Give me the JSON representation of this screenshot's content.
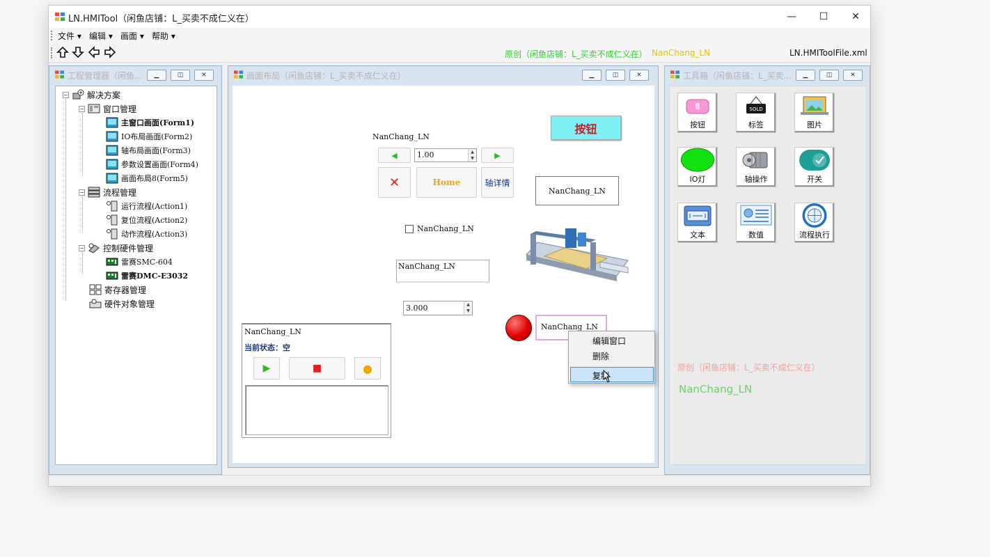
{
  "window": {
    "title": "LN.HMITool（闲鱼店铺：L_买卖不成仁义在）",
    "minimize": "—",
    "maximize": "☐",
    "close": "✕"
  },
  "menu": [
    "文件 ▾",
    "编辑 ▾",
    "画面 ▾",
    "帮助 ▾"
  ],
  "toolbar": {
    "arrows": [
      "up-arrow-icon",
      "down-arrow-icon",
      "left-arrow-icon",
      "right-arrow-icon"
    ],
    "credit_green": "原创（闲鱼店铺：L_买卖不成仁义在）",
    "credit_yellow": "NanChang_LN",
    "file_name": "LN.HMIToolFile.xml"
  },
  "project_manager": {
    "title": "工程管理器（闲鱼...",
    "root": "解决方案",
    "window_mgmt": "窗口管理",
    "forms": [
      "主窗口画面(Form1)",
      "IO布局画面(Form2)",
      "轴布局画面(Form3)",
      "参数设置画面(Form4)",
      "画面布局8(Form5)"
    ],
    "flow_mgmt": "流程管理",
    "flows": [
      "运行流程(Action1)",
      "复位流程(Action2)",
      "动作流程(Action3)"
    ],
    "hw_mgmt": "控制硬件管理",
    "hardware": [
      "雷赛SMC-604",
      "雷赛DMC-E3032"
    ],
    "register_mgmt": "寄存器管理",
    "hw_object_mgmt": "硬件对象管理"
  },
  "layout_window": {
    "title": "画面布局（闲鱼店铺：L_买卖不成仁义在）",
    "axis_label": "NanChang_LN",
    "axis_value": "1.00",
    "left_arrow": "◀",
    "right_arrow": "▶",
    "stop_mark": "✕",
    "home_label": "Home",
    "axis_detail": "轴详情",
    "button_label": "按钮",
    "label_box_text": "NanChang_LN",
    "checkbox_text": "NanChang_LN",
    "textbox_text": "NanChang_LN",
    "numeric_value": "3.000",
    "selected_label": "NanChang_LN",
    "flow_panel": {
      "title": "NanChang_LN",
      "status": "当前状态：空",
      "run": "▶",
      "stop": "■",
      "pause": "●"
    },
    "context_menu": [
      "编辑窗口",
      "删除",
      "复制"
    ]
  },
  "toolbox": {
    "title": "工具箱（闲鱼店铺：L_买卖...",
    "tools": [
      "按钮",
      "标签",
      "图片",
      "IO灯",
      "轴操作",
      "开关",
      "文本",
      "数值",
      "流程执行"
    ],
    "credit_pink": "原创（闲鱼店铺：L_买卖不成仁义在）",
    "credit_green": "NanChang_LN"
  },
  "colors": {
    "green_credit": "#33cc33",
    "yellow_credit": "#e6c200",
    "pink_credit": "#f2a0a0",
    "io_lamp": "#e00000",
    "button_cyan": "#7ff0f4"
  }
}
